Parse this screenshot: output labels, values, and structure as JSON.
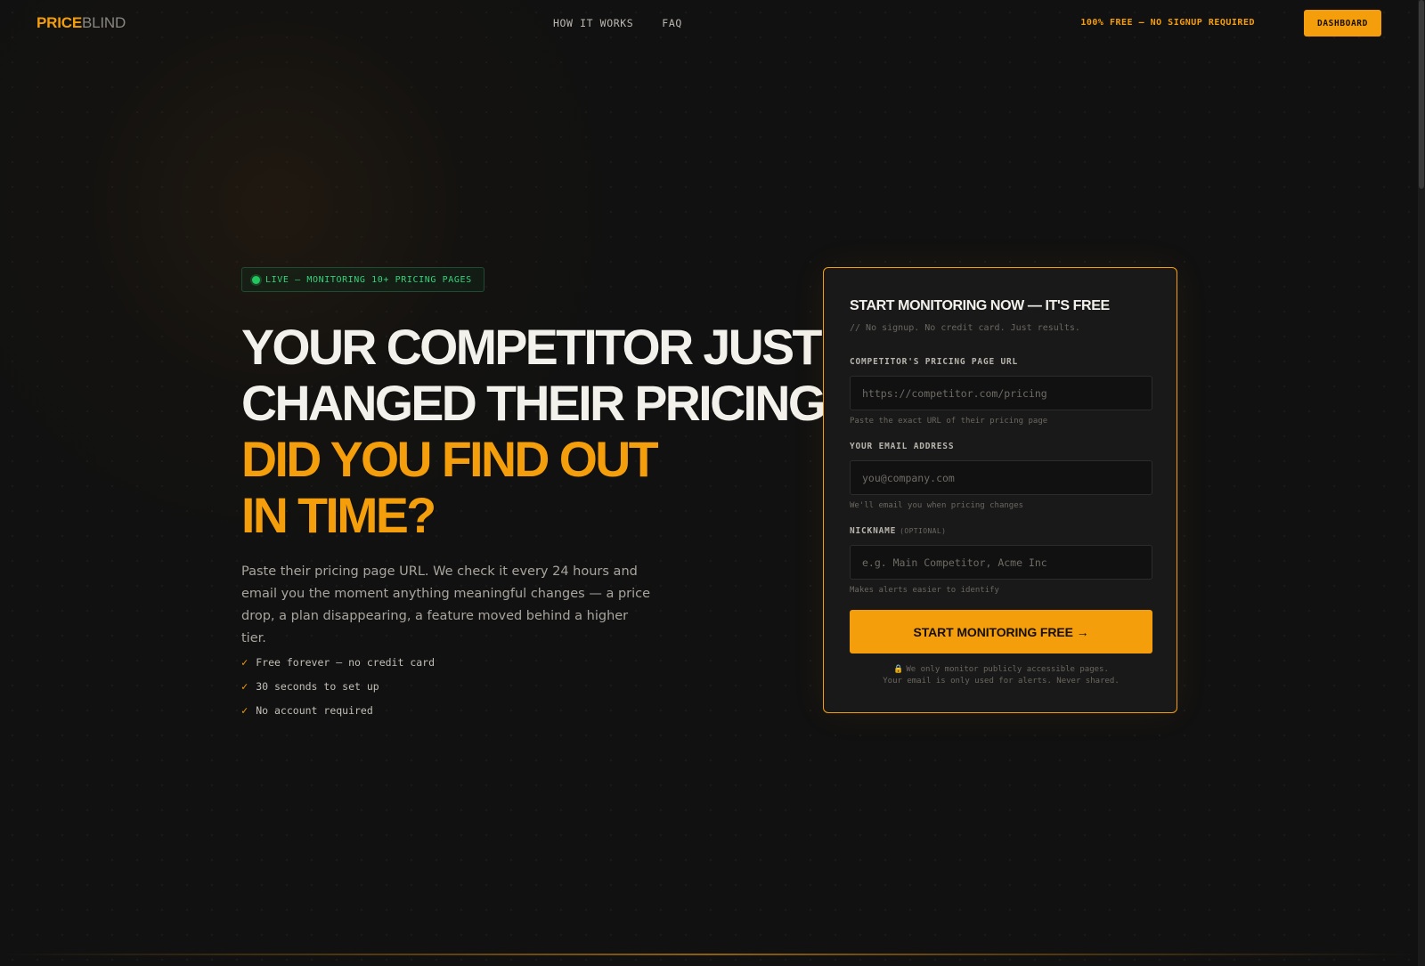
{
  "nav": {
    "logo_bold": "PRICE",
    "logo_light": "BLIND",
    "links": [
      "HOW IT WORKS",
      "FAQ"
    ],
    "free_note": "100% FREE — NO SIGNUP REQUIRED",
    "dashboard_label": "DASHBOARD"
  },
  "hero": {
    "badge": "LIVE — MONITORING 10+ PRICING PAGES",
    "headline_lines": [
      "YOUR COMPETITOR JUST",
      "CHANGED THEIR PRICING."
    ],
    "headline_accent_lines": [
      "DID YOU FIND OUT",
      "IN TIME?"
    ],
    "subtext": "Paste their pricing page URL. We check it every 24 hours and email you the moment anything meaningful changes — a price drop, a plan disappearing, a feature moved behind a higher tier.",
    "checks": [
      "Free forever — no credit card",
      "30 seconds to set up",
      "No account required"
    ],
    "check_icon": "✓"
  },
  "form": {
    "title": "START MONITORING NOW — IT'S FREE",
    "subtitle": "// No signup. No credit card. Just results.",
    "url": {
      "label": "COMPETITOR'S PRICING PAGE URL",
      "placeholder": "https://competitor.com/pricing",
      "value": "",
      "hint": "Paste the exact URL of their pricing page"
    },
    "email": {
      "label": "YOUR EMAIL ADDRESS",
      "placeholder": "you@company.com",
      "value": "",
      "hint": "We'll email you when pricing changes"
    },
    "nickname": {
      "label": "NICKNAME",
      "optional": "(OPTIONAL)",
      "placeholder": "e.g. Main Competitor, Acme Inc",
      "value": "",
      "hint": "Makes alerts easier to identify"
    },
    "submit_label": "START MONITORING FREE →",
    "lock_icon": "🔒",
    "disclaimer_line1": "We only monitor publicly accessible pages.",
    "disclaimer_line2": "Your email is only used for alerts. Never shared."
  },
  "colors": {
    "accent": "#f59e0b",
    "live": "#22c55e",
    "background": "#111111",
    "card": "#191919"
  }
}
